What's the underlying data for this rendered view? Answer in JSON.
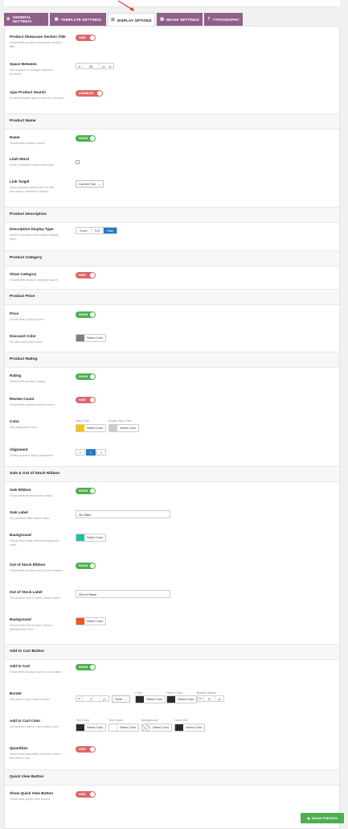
{
  "tabs": [
    {
      "icon": "⚙",
      "label": "GENERAL SETTINGS"
    },
    {
      "icon": "▣",
      "label": "TEMPLATE SETTINGS"
    },
    {
      "icon": "☷",
      "label": "DISPLAY OPTIONS"
    },
    {
      "icon": "▨",
      "label": "IMAGE SETTINGS"
    },
    {
      "icon": "T",
      "label": "TYPOGRAPHY"
    }
  ],
  "sections": {
    "product_name": "Product Name",
    "product_description": "Product Description",
    "product_category": "Product Category",
    "product_price": "Product Price",
    "product_rating": "Product Rating",
    "sale_ribbon": "Sale & Out of Stock Ribbon",
    "add_to_cart": "Add to Cart Button",
    "quick_view": "Quick View Button"
  },
  "fields": {
    "showcase_title": {
      "label": "Product Showcase Section Title",
      "desc": "Show/Hide product showcase section title.",
      "toggle": "HIDE"
    },
    "space_between": {
      "label": "Space Between",
      "desc": "Set a space or margin between products.",
      "value": "20",
      "unit": "px"
    },
    "ajax_search": {
      "label": "Ajax Product Search",
      "desc": "Enable/Disable ajax search for product.",
      "toggle": "DISABLED"
    },
    "name": {
      "label": "Name",
      "desc": "Show/Hide product name.",
      "toggle": "SHOW"
    },
    "limit_word": {
      "label": "Limit Word",
      "desc": "Limit to product name word limit."
    },
    "link_target": {
      "label": "Link Target",
      "desc": "Open product when click on title, thumbnail, readmore button.",
      "value": "Current Tab"
    },
    "desc_type": {
      "label": "Description Display Type",
      "desc": "Select a product description display type.",
      "options": [
        "Short",
        "Full",
        "Hide"
      ]
    },
    "show_category": {
      "label": "Show Category",
      "desc": "Show/Hide product category name.",
      "toggle": "HIDE"
    },
    "price": {
      "label": "Price",
      "desc": "Show/Hide product price.",
      "toggle": "SHOW"
    },
    "discount_color": {
      "label": "Discount Color",
      "desc": "Set discount price color.",
      "btn": "Select Color"
    },
    "rating": {
      "label": "Rating",
      "desc": "Show/Hide product rating.",
      "toggle": "SHOW"
    },
    "review_count": {
      "label": "Review Count",
      "desc": "Show/Hide product review count.",
      "toggle": "HIDE"
    },
    "rating_color": {
      "label": "Color",
      "desc": "Set rating star color.",
      "star": "Star Color",
      "empty": "Empty Star Color",
      "btn": "Select Color"
    },
    "alignment": {
      "label": "Alignment",
      "desc": "Select product rating alignment."
    },
    "sale_ribbon": {
      "label": "Sale Ribbon",
      "desc": "Show/Hide product sale ribbon.",
      "toggle": "SHOW"
    },
    "sale_label": {
      "label": "Sale Label",
      "desc": "Set product sale ribbon label.",
      "value": "On Sale!"
    },
    "sale_bg": {
      "label": "Background",
      "desc": "Set product sale ribbon background color.",
      "btn": "Select Color"
    },
    "oos_ribbon": {
      "label": "Out of Stock Ribbon",
      "desc": "Show/Hide product out of stock ribbon.",
      "toggle": "SHOW"
    },
    "oos_label": {
      "label": "Out of Stock Label",
      "desc": "Set product out of stock ribbon label.",
      "value": "Out of Stock"
    },
    "oos_bg": {
      "label": "Background",
      "desc": "Set product out of stock ribbon background color.",
      "btn": "Select Color"
    },
    "cart": {
      "label": "Add to Cart",
      "desc": "Show/Hide product add to cart button.",
      "toggle": "SHOW"
    },
    "border": {
      "label": "Border",
      "desc": "Set add to cart button border.",
      "width": "1",
      "unit": "px",
      "style": "Solid",
      "color": "Color",
      "hover": "Hover Color",
      "radius_label": "Border Radius",
      "radius": "0",
      "btn": "Select Color"
    },
    "cart_color": {
      "label": "Add to Cart Color",
      "desc": "Set product add to cart button color.",
      "c1": "Text Color",
      "c2": "Text Hover",
      "c3": "Background",
      "c4": "Hover BG",
      "btn": "Select Color"
    },
    "quantities": {
      "label": "Quantities",
      "desc": "Show/Hide quantities selector before the add to cart.",
      "toggle": "HIDE"
    },
    "quick_view": {
      "label": "Show Quick View Button",
      "desc": "Show/Hide quick view button.",
      "toggle": "HIDE"
    }
  },
  "preview": "SHOW PREVIEW",
  "colors": {
    "tab": "#8f5f8b",
    "on": "#4caf50",
    "off": "#e06666",
    "accent": "#1e7bc6",
    "discount": "#7f7f7f",
    "star": "#f5c400",
    "empty_star": "#cccccc",
    "sale_bg": "#1dbf9f",
    "oos_bg": "#f4511e",
    "dark": "#2b2b2b"
  }
}
